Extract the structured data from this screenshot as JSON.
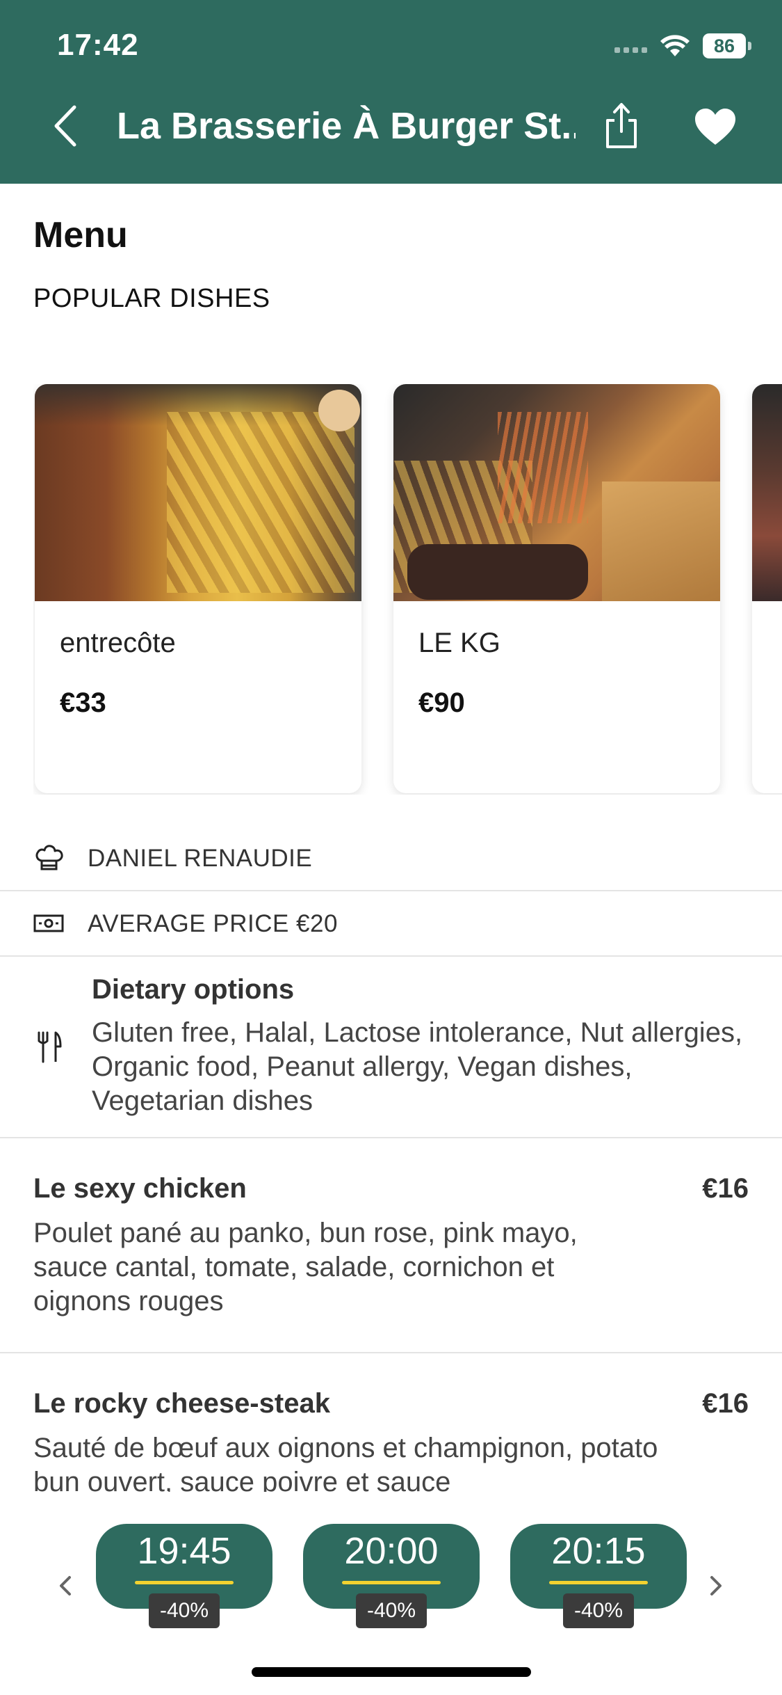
{
  "status_bar": {
    "time": "17:42",
    "battery": "86"
  },
  "header": {
    "title": "La Brasserie À Burger St..."
  },
  "menu": {
    "heading": "Menu",
    "popular_heading": "POPULAR DISHES",
    "popular_dishes": [
      {
        "name": "entrecôte",
        "price": "€33"
      },
      {
        "name": "LE KG",
        "price": "€90"
      },
      {
        "name": "",
        "price": ""
      }
    ]
  },
  "info": {
    "chef": "DANIEL RENAUDIE",
    "average_price": "AVERAGE PRICE €20",
    "dietary_title": "Dietary options",
    "dietary_text": "Gluten free, Halal, Lactose intolerance, Nut allergies, Organic food, Peanut allergy, Vegan dishes, Vegetarian dishes"
  },
  "dishes": [
    {
      "name": "Le sexy chicken",
      "price": "€16",
      "description": "Poulet pané au panko, bun rose, pink mayo, sauce cantal, tomate, salade, cornichon et oignons rouges"
    },
    {
      "name": "Le rocky cheese-steak",
      "price": "€16",
      "description": "Sauté de bœuf aux oignons et champignon, potato bun ouvert, sauce poivre et sauce"
    }
  ],
  "booking": {
    "slots": [
      {
        "time": "19:45",
        "discount": "-40%"
      },
      {
        "time": "20:00",
        "discount": "-40%"
      },
      {
        "time": "20:15",
        "discount": "-40%"
      }
    ]
  },
  "colors": {
    "brand": "#2e6b5f",
    "accent": "#f3d230"
  },
  "icons": [
    "chevron-left-icon",
    "share-icon",
    "heart-icon",
    "chef-hat-icon",
    "banknote-icon",
    "fork-knife-icon",
    "chevron-right-icon"
  ]
}
